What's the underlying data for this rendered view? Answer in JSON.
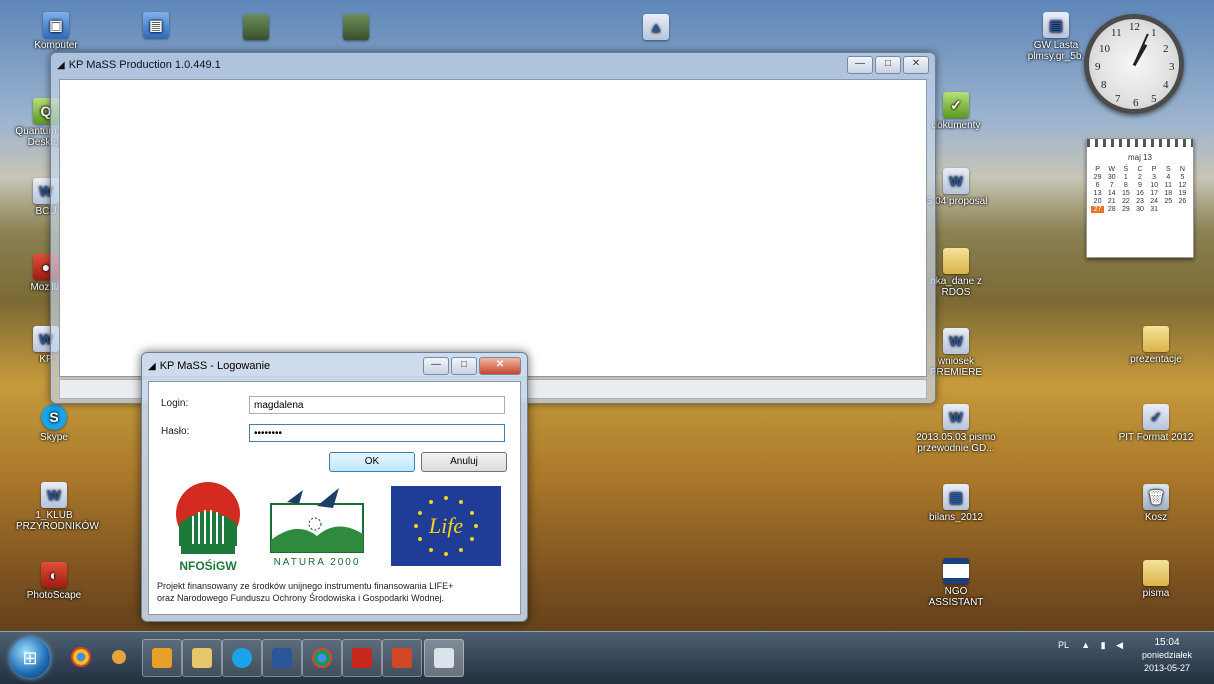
{
  "desktop": {
    "icons_left": [
      {
        "label": "Komputer",
        "icon": "computer-icon"
      },
      {
        "label": "Quantum GIS Desktop",
        "icon": "qgis-icon"
      },
      {
        "label": "BCU",
        "icon": "doc-icon"
      },
      {
        "label": "Mozilla",
        "icon": "firefox-icon"
      },
      {
        "label": "KP",
        "icon": "doc-icon"
      },
      {
        "label": "Skype",
        "icon": "skype-icon"
      },
      {
        "label": "1_KLUB PRZYRODNIKÓW",
        "icon": "doc-icon"
      },
      {
        "label": "PhotoScape",
        "icon": "photoscape-icon"
      }
    ],
    "icons_top": [
      {
        "label": "",
        "icon": "pc-icon"
      },
      {
        "label": "",
        "icon": "image-icon"
      },
      {
        "label": "",
        "icon": "image-icon"
      },
      {
        "label": "",
        "icon": "image-icon"
      }
    ],
    "icons_middle": [
      {
        "label": "dokumenty",
        "icon": "green-app-icon"
      },
      {
        "label": "G 04 proposal",
        "icon": "doc-icon"
      },
      {
        "label": "nka_dane z RDOS",
        "icon": "folder-icon"
      },
      {
        "label": "wniosek PREMIERE",
        "icon": "doc-icon"
      },
      {
        "label": "2013.05.03 pismo przewodnie GD...",
        "icon": "doc-icon"
      },
      {
        "label": "bilans_2012",
        "icon": "doc-icon"
      },
      {
        "label": "NGO ASSISTANT",
        "icon": "ngo-icon"
      }
    ],
    "icons_right": [
      {
        "label": "GW Lasta plmsy.gr_5b.",
        "icon": "doc-icon"
      },
      {
        "label": "prezentacje",
        "icon": "folder-icon"
      },
      {
        "label": "PIT Format 2012",
        "icon": "pit-icon"
      },
      {
        "label": "Kosz",
        "icon": "trash-icon"
      },
      {
        "label": "pisma",
        "icon": "folder-icon"
      }
    ]
  },
  "main_window": {
    "title": "KP MaSS Production 1.0.449.1",
    "minimize": "—",
    "maximize": "□",
    "close": "✕"
  },
  "login_dialog": {
    "title": "KP MaSS - Logowanie",
    "login_label": "Login:",
    "login_value": "magdalena",
    "password_label": "Hasło:",
    "password_value": "••••••••",
    "ok_label": "OK",
    "cancel_label": "Anuluj",
    "logos": {
      "nfosigw": "NFOŚiGW",
      "natura": "NATURA 2000",
      "life": "Life"
    },
    "footer_line1": "Projekt finansowany ze środków unijnego instrumentu finansowania LIFE+",
    "footer_line2": "oraz Narodowego Funduszu Ochrony Środowiska i Gospodarki Wodnej."
  },
  "gadgets": {
    "clock_numbers": [
      "12",
      "1",
      "2",
      "3",
      "4",
      "5",
      "6",
      "7",
      "8",
      "9",
      "10",
      "11"
    ],
    "calendar_month": "maj 13",
    "calendar_days_header": [
      "P",
      "W",
      "Ś",
      "C",
      "P",
      "S",
      "N"
    ],
    "calendar_days": [
      "29",
      "30",
      "1",
      "2",
      "3",
      "4",
      "5",
      "6",
      "7",
      "8",
      "9",
      "10",
      "11",
      "12",
      "13",
      "14",
      "15",
      "16",
      "17",
      "18",
      "19",
      "20",
      "21",
      "22",
      "23",
      "24",
      "25",
      "26",
      "27",
      "28",
      "29",
      "30",
      "31",
      "",
      "",
      ""
    ],
    "today": "27"
  },
  "taskbar": {
    "tray_lang": "PL",
    "time": "15:04",
    "day": "poniedziałek",
    "date": "2013-05-27"
  }
}
